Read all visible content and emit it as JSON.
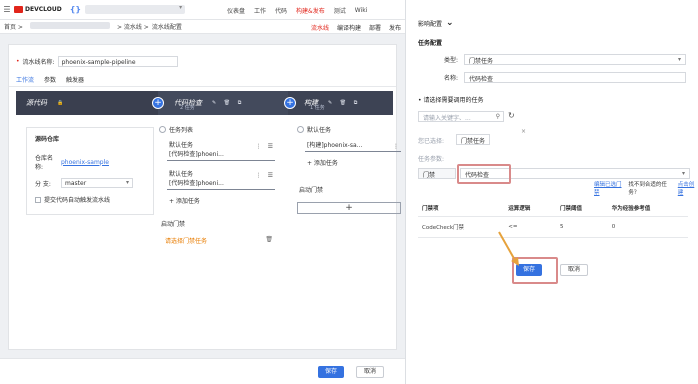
{
  "topbar": {
    "logo": "DEVCLOUD",
    "brace": "{}",
    "nav": [
      "仪表盘",
      "工作",
      "代码",
      "构建&发布",
      "测试",
      "Wiki"
    ],
    "active_nav": "构建&发布"
  },
  "subbar": {
    "crumb_home": "首页 >",
    "crumb_pipeline": "> 流水线 >",
    "crumb_config": "流水线配置",
    "tabs": [
      "流水线",
      "编译构建",
      "部署",
      "发布"
    ]
  },
  "pipeline": {
    "name_label": "流水线名称:",
    "name_value": "phoenix-sample-pipeline",
    "tabs": [
      "工作流",
      "参数",
      "触发器"
    ]
  },
  "stages": [
    {
      "title": "源代码",
      "sub": ""
    },
    {
      "title": "代码检查",
      "sub": "2 任务"
    },
    {
      "title": "构建",
      "sub": "1 任务"
    }
  ],
  "source": {
    "title": "源码仓库",
    "repo_label": "仓库名称:",
    "repo_value": "phoenix-sample",
    "branch_label": "分    支:",
    "branch_value": "master",
    "trigger_label": "提交代码自动触发流水线"
  },
  "codecheck": {
    "list_title": "任务列表",
    "tasks": [
      {
        "name": "默认任务",
        "detail": "[代码检查]phoeni..."
      },
      {
        "name": "默认任务",
        "detail": "[代码检查]phoeni..."
      }
    ],
    "add_task": "+ 添加任务",
    "gate_title": "启动门禁",
    "gate_select": "请选择门禁任务"
  },
  "build": {
    "list_title": "默认任务",
    "task_detail": "[构建]phoenix-sa...",
    "add_task": "+ 添加任务",
    "gate_title": "启动门禁",
    "plus": "+"
  },
  "footer": {
    "save": "保存",
    "cancel": "取消"
  },
  "right": {
    "title": "影响配置",
    "task_config": "任务配置",
    "type_label": "类型:",
    "type_value": "门禁任务",
    "name_label": "名称:",
    "name_value": "代码检查",
    "select_title": "• 请选择需要调用的任务",
    "search_placeholder": "请输入关键字、...",
    "selected_label": "您已选择:",
    "selected_tag": "门禁任务",
    "params_label": "任务参数:",
    "gate_label": "门禁",
    "gate_value": "代码检查",
    "edit_link": "编辑已选门禁",
    "no_match": "找不到合适的任务？",
    "create_link": "点击创建",
    "table": {
      "headers": [
        "门禁项",
        "运算逻辑",
        "门禁阈值",
        "华为经验参考值"
      ],
      "rows": [
        [
          "CodeCheck门禁",
          "<=",
          "5",
          "0"
        ]
      ]
    },
    "save": "保存",
    "cancel": "取消"
  }
}
